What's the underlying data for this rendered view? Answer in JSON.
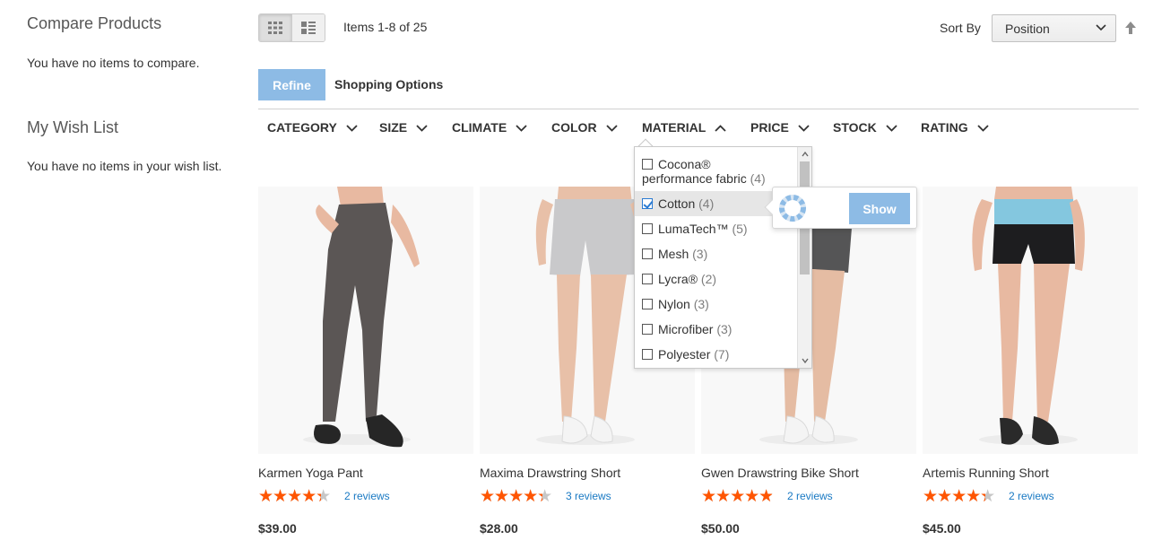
{
  "sidebar": {
    "compare_title": "Compare Products",
    "compare_empty": "You have no items to compare.",
    "wishlist_title": "My Wish List",
    "wishlist_empty": "You have no items in your wish list."
  },
  "toolbar": {
    "grid_icon": "grid-view-icon",
    "list_icon": "list-view-icon",
    "items_count": "Items 1-8 of 25",
    "sort_label": "Sort By",
    "sort_value": "Position",
    "sort_dir_icon": "arrow-up-icon"
  },
  "refine": {
    "button": "Refine",
    "title": "Shopping Options"
  },
  "filters": [
    {
      "label": "CATEGORY",
      "expanded": false
    },
    {
      "label": "SIZE",
      "expanded": false
    },
    {
      "label": "CLIMATE",
      "expanded": false
    },
    {
      "label": "COLOR",
      "expanded": false
    },
    {
      "label": "MATERIAL",
      "expanded": true
    },
    {
      "label": "PRICE",
      "expanded": false
    },
    {
      "label": "STOCK",
      "expanded": false
    },
    {
      "label": "RATING",
      "expanded": false
    }
  ],
  "material_options": [
    {
      "label_line1": "Cocona®",
      "label_line2": "performance fabric",
      "count": "(4)",
      "checked": false
    },
    {
      "label": "Cotton",
      "count": "(4)",
      "checked": true
    },
    {
      "label": "LumaTech™",
      "count": "(5)",
      "checked": false
    },
    {
      "label": "Mesh",
      "count": "(3)",
      "checked": false
    },
    {
      "label": "Lycra®",
      "count": "(2)",
      "checked": false
    },
    {
      "label": "Nylon",
      "count": "(3)",
      "checked": false
    },
    {
      "label": "Microfiber",
      "count": "(3)",
      "checked": false
    },
    {
      "label": "Polyester",
      "count": "(7)",
      "checked": false
    }
  ],
  "popup": {
    "show_button": "Show",
    "spinner_icon": "loading-spinner-icon"
  },
  "products": [
    {
      "name": "Karmen Yoga Pant",
      "rating": 0.8,
      "reviews": "2 reviews",
      "price": "$39.00"
    },
    {
      "name": "Maxima Drawstring Short",
      "rating": 0.8,
      "reviews": "3 reviews",
      "price": "$28.00"
    },
    {
      "name": "Gwen Drawstring Bike Short",
      "rating": 0.9,
      "reviews": "2 reviews",
      "price": "$50.00"
    },
    {
      "name": "Artemis Running Short",
      "rating": 0.8,
      "reviews": "2 reviews",
      "price": "$45.00"
    }
  ],
  "colors": {
    "accent": "#8dbbe5",
    "star": "#ff5501",
    "link": "#1979c3"
  }
}
